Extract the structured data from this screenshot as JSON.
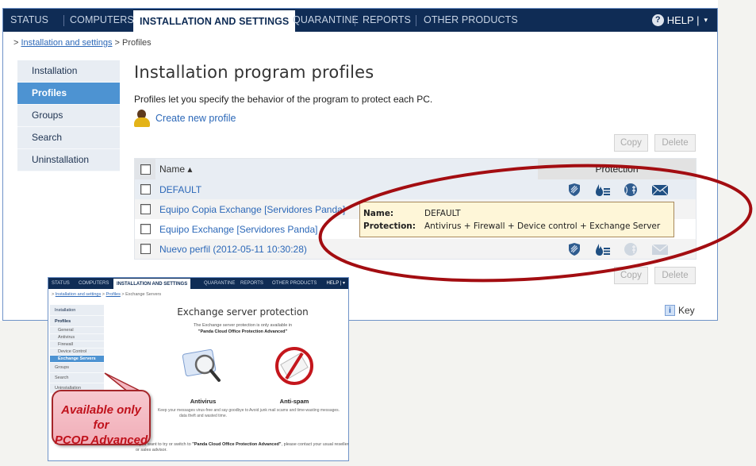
{
  "topnav": {
    "tabs": [
      {
        "label": "STATUS"
      },
      {
        "label": "COMPUTERS"
      },
      {
        "label": "INSTALLATION AND SETTINGS",
        "active": true
      },
      {
        "label": "QUARANTINE"
      },
      {
        "label": "REPORTS"
      },
      {
        "label": "OTHER PRODUCTS"
      }
    ],
    "help_label": "HELP |",
    "help_icon": "question-circle-icon",
    "help_caret": "▾"
  },
  "breadcrumb": {
    "root": "> ",
    "link": "Installation and settings",
    "sep": " > ",
    "current": "Profiles"
  },
  "sidebar": {
    "items": [
      {
        "label": "Installation"
      },
      {
        "label": "Profiles",
        "active": true
      },
      {
        "label": "Groups"
      },
      {
        "label": "Search"
      },
      {
        "label": "Uninstallation"
      }
    ]
  },
  "main": {
    "title": "Installation program profiles",
    "description": "Profiles let you specify the behavior of the program to protect each PC.",
    "create_link": "Create new profile",
    "copy_label": "Copy",
    "delete_label": "Delete",
    "table": {
      "columns": {
        "name": "Name ▴",
        "protection": "Protection"
      },
      "rows": [
        {
          "name": "DEFAULT",
          "protections": {
            "antivirus": true,
            "firewall": true,
            "device_control": true,
            "exchange": true
          }
        },
        {
          "name": "Equipo Copia Exchange [Servidores Panda]",
          "protections": null
        },
        {
          "name": "Equipo Exchange [Servidores Panda]",
          "protections": null
        },
        {
          "name": "Nuevo perfil (2012-05-11 10:30:28)",
          "protections": {
            "antivirus": true,
            "firewall": true,
            "device_control": false,
            "exchange": false
          }
        }
      ]
    },
    "tooltip": {
      "name_label": "Name:",
      "name_value": "DEFAULT",
      "protection_label": "Protection:",
      "protection_value": "Antivirus + Firewall + Device control + Exchange Server"
    },
    "key_label": "Key",
    "key_icon": "info-icon"
  },
  "annotation": {
    "ellipse_color": "#a30d11",
    "callout_text_line1": "Available only for",
    "callout_text_line2": "PCOP Advanced"
  },
  "inset": {
    "tabs": [
      "STATUS",
      "COMPUTERS",
      "INSTALLATION AND SETTINGS",
      "QUARANTINE",
      "REPORTS",
      "OTHER PRODUCTS"
    ],
    "help_label": "HELP | ▾",
    "breadcrumb_link1": "Installation and settings",
    "breadcrumb_link2": "Profiles",
    "breadcrumb_current": "Exchange Servers",
    "sidebar": [
      {
        "label": "Installation",
        "type": "bold-plain"
      },
      {
        "label": "Profiles",
        "type": "bold"
      },
      {
        "label": "General",
        "type": "sub"
      },
      {
        "label": "Antivirus",
        "type": "sub"
      },
      {
        "label": "Firewall",
        "type": "sub"
      },
      {
        "label": "Device Control",
        "type": "sub"
      },
      {
        "label": "Exchange Servers",
        "type": "sub-active"
      },
      {
        "label": "Groups",
        "type": "plain"
      },
      {
        "label": "Search",
        "type": "plain"
      },
      {
        "label": "Uninstallation",
        "type": "plain"
      }
    ],
    "title": "Exchange server protection",
    "subtitle_line1": "The Exchange server protection is only available in",
    "subtitle_line2": "\"Panda Cloud Office Protection Advanced\"",
    "features": [
      {
        "name": "Antivirus",
        "desc": "Keep your messages virus-free and say goodbye to data theft and wasted time."
      },
      {
        "name": "Anti-spam",
        "desc": "Avoid junk mail scams and time-wasting messages."
      }
    ],
    "footer_pre": "If you want to try or switch to ",
    "footer_bold": "\"Panda Cloud Office Protection Advanced\"",
    "footer_post": ", please contact your usual reseller or sales advisor."
  }
}
